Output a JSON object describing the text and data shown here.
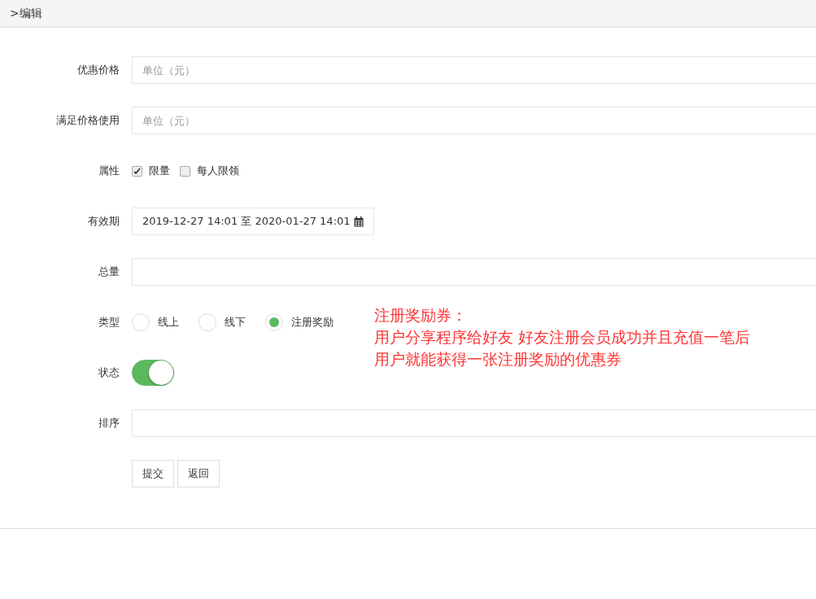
{
  "breadcrumb": ">编辑",
  "rows": [
    {
      "kind": "input",
      "label": "优惠价格",
      "placeholder": "单位（元）"
    },
    {
      "kind": "input",
      "label": "满足价格使用",
      "placeholder": "单位（元）"
    },
    {
      "kind": "checkboxes",
      "label": "属性",
      "options": [
        {
          "label": "限量",
          "checked": true
        },
        {
          "label": "每人限领",
          "checked": false
        }
      ]
    },
    {
      "kind": "daterange",
      "label": "有效期",
      "value": "2019-12-27 14:01 至 2020-01-27 14:01"
    },
    {
      "kind": "input",
      "label": "总量"
    },
    {
      "kind": "radios",
      "label": "类型",
      "options": [
        {
          "label": "线上",
          "selected": false
        },
        {
          "label": "线下",
          "selected": false
        },
        {
          "label": "注册奖励",
          "selected": true
        }
      ]
    },
    {
      "kind": "switch",
      "label": "状态",
      "on": true
    },
    {
      "kind": "input",
      "label": "排序"
    },
    {
      "kind": "buttons",
      "buttons": [
        "提交",
        "返回"
      ]
    }
  ],
  "annotation": [
    "注册奖励券：",
    "用户分享程序给好友 好友注册会员成功并且充值一笔后",
    "用户就能获得一张注册奖励的优惠券"
  ]
}
